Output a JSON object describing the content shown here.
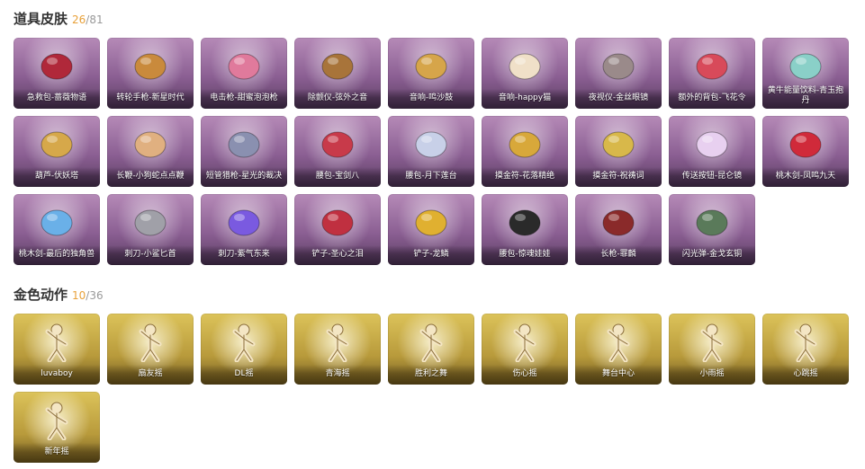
{
  "sections": [
    {
      "title": "道具皮肤",
      "owned": "26",
      "total": "/81",
      "items": [
        {
          "label": "急救包-蔷薇物语",
          "icon": "medkit-icon"
        },
        {
          "label": "转轮手枪-新星时代",
          "icon": "revolver-icon"
        },
        {
          "label": "电击枪-甜蜜泡泡枪",
          "icon": "stun-gun-icon"
        },
        {
          "label": "除颤仪-弦外之音",
          "icon": "lute-icon"
        },
        {
          "label": "音响-鸣沙鼓",
          "icon": "drum-icon"
        },
        {
          "label": "音响-happy猫",
          "icon": "cat-icon"
        },
        {
          "label": "夜视仪-金丝眼镜",
          "icon": "glasses-icon"
        },
        {
          "label": "额外的背包-飞花令",
          "icon": "flower-bag-icon"
        },
        {
          "label": "黄牛能量饮料-青玉抱丹",
          "icon": "vase-icon"
        },
        {
          "label": "葫芦-伏妖塔",
          "icon": "pagoda-icon"
        },
        {
          "label": "长鞭-小狗蛇点点鞭",
          "icon": "puppy-icon"
        },
        {
          "label": "短管猎枪-星光的裁决",
          "icon": "shotgun-icon"
        },
        {
          "label": "腰包-宝剑八",
          "icon": "heart-badge-icon"
        },
        {
          "label": "腰包-月下莲台",
          "icon": "lotus-staff-icon"
        },
        {
          "label": "摸金符-花落精绝",
          "icon": "amulet-icon"
        },
        {
          "label": "摸金符-祝祷词",
          "icon": "cross-amulet-icon"
        },
        {
          "label": "传送按钮-昆仑镜",
          "icon": "mirror-icon"
        },
        {
          "label": "桃木剑-凤鸣九天",
          "icon": "red-sword-icon"
        },
        {
          "label": "桃木剑-最后的独角兽",
          "icon": "unicorn-sword-icon"
        },
        {
          "label": "刺刀-小鲨匕首",
          "icon": "shark-dagger-icon"
        },
        {
          "label": "刺刀-紫气东来",
          "icon": "purple-dagger-icon"
        },
        {
          "label": "铲子-圣心之泪",
          "icon": "scepter-icon"
        },
        {
          "label": "铲子-龙鳞",
          "icon": "golden-shovel-icon"
        },
        {
          "label": "腰包-惊魂娃娃",
          "icon": "skull-doll-icon"
        },
        {
          "label": "长枪-罪麟",
          "icon": "spear-icon"
        },
        {
          "label": "闪光弹-金戈玄铜",
          "icon": "grenade-icon"
        }
      ]
    },
    {
      "title": "金色动作",
      "owned": "10",
      "total": "/36",
      "items": [
        {
          "label": "luvaboy",
          "icon": "dance-pose-icon"
        },
        {
          "label": "扇友摇",
          "icon": "dance-pose-icon"
        },
        {
          "label": "DL摇",
          "icon": "dance-pose-icon"
        },
        {
          "label": "青海摇",
          "icon": "dance-pose-icon"
        },
        {
          "label": "胜利之舞",
          "icon": "dance-pose-icon"
        },
        {
          "label": "伤心摇",
          "icon": "dance-pose-icon"
        },
        {
          "label": "舞台中心",
          "icon": "dance-pose-icon"
        },
        {
          "label": "小雨摇",
          "icon": "dance-pose-icon"
        },
        {
          "label": "心跳摇",
          "icon": "dance-pose-icon"
        },
        {
          "label": "新年摇",
          "icon": "dance-pose-icon"
        }
      ]
    }
  ],
  "colors": {
    "accent_count": "#e8a13a",
    "card_purple": "#8b5f93",
    "card_gold": "#b89a3b"
  }
}
